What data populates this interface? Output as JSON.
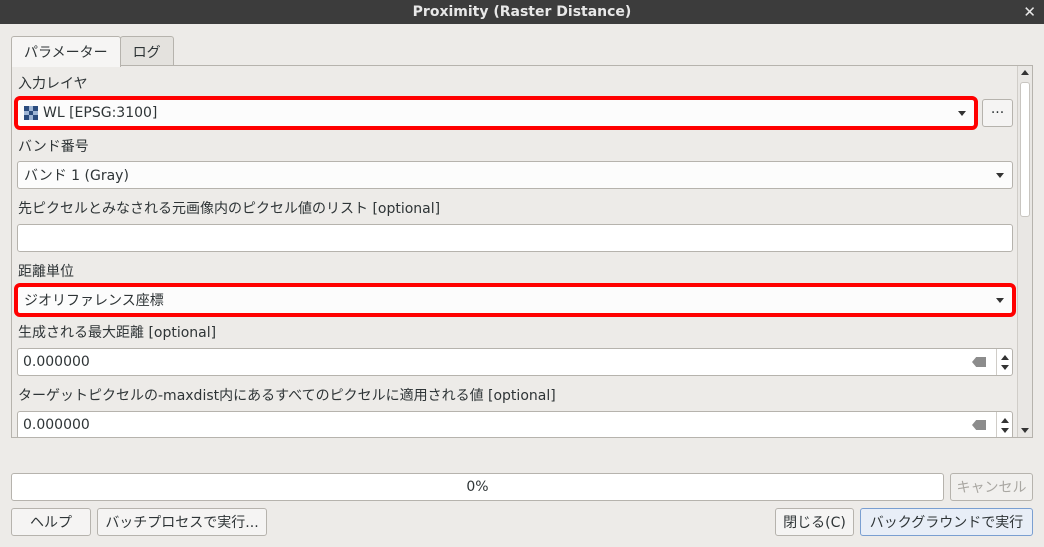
{
  "window": {
    "title": "Proximity (Raster Distance)"
  },
  "tabs": [
    {
      "label": "パラメーター"
    },
    {
      "label": "ログ"
    }
  ],
  "params": {
    "input_layer": {
      "label": "入力レイヤ",
      "value": "WL [EPSG:3100]",
      "browse": "···"
    },
    "band": {
      "label": "バンド番号",
      "value": "バンド 1 (Gray)"
    },
    "target_values": {
      "label": "先ピクセルとみなされる元画像内のピクセル値のリスト [optional]",
      "value": ""
    },
    "units": {
      "label": "距離単位",
      "value": "ジオリファレンス座標"
    },
    "max_distance": {
      "label": "生成される最大距離 [optional]",
      "value": "0.000000"
    },
    "replace_value": {
      "label": "ターゲットピクセルの-maxdist内にあるすべてのピクセルに適用される値 [optional]",
      "value": "0.000000"
    }
  },
  "progress": {
    "text": "0%",
    "value": 0
  },
  "buttons": {
    "cancel": "キャンセル",
    "help": "ヘルプ",
    "batch": "バッチプロセスで実行...",
    "close": "閉じる(C)",
    "run_background": "バックグラウンドで実行"
  },
  "colors": {
    "highlight": "#ff0000",
    "titlebar": "#3c3c3c"
  }
}
